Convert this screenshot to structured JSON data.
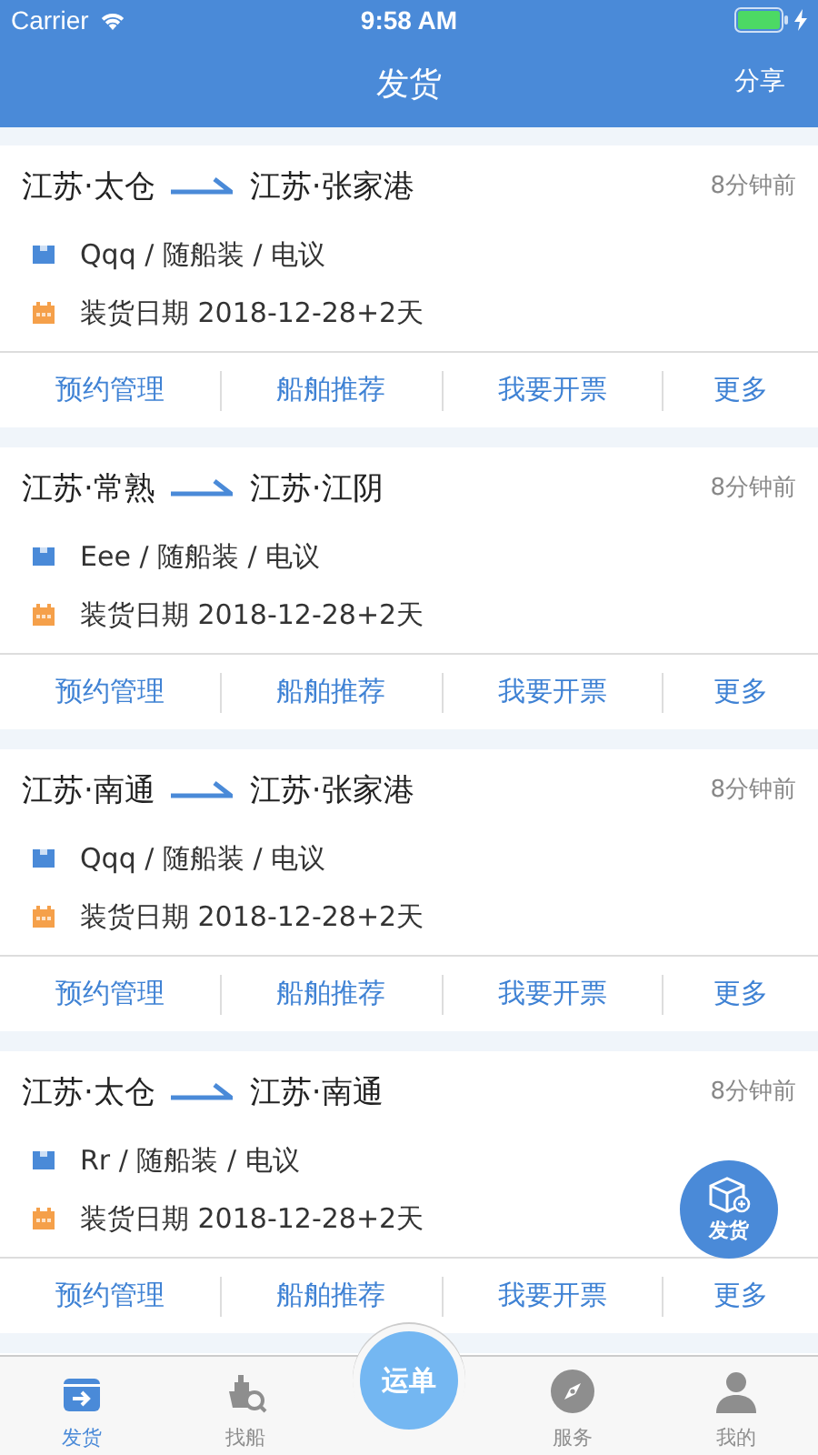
{
  "status_bar": {
    "carrier": "Carrier",
    "time": "9:58 AM",
    "battery_charging": true
  },
  "nav": {
    "title": "发货",
    "action": "分享"
  },
  "orders": [
    {
      "from": "江苏·太仓",
      "to": "江苏·张家港",
      "time": "8分钟前",
      "cargo": "Qqq / 随船装 / 电议",
      "date": "装货日期 2018-12-28+2天",
      "actions": [
        "预约管理",
        "船舶推荐",
        "我要开票",
        "更多"
      ]
    },
    {
      "from": "江苏·常熟",
      "to": "江苏·江阴",
      "time": "8分钟前",
      "cargo": "Eee / 随船装 / 电议",
      "date": "装货日期 2018-12-28+2天",
      "actions": [
        "预约管理",
        "船舶推荐",
        "我要开票",
        "更多"
      ]
    },
    {
      "from": "江苏·南通",
      "to": "江苏·张家港",
      "time": "8分钟前",
      "cargo": "Qqq / 随船装 / 电议",
      "date": "装货日期 2018-12-28+2天",
      "actions": [
        "预约管理",
        "船舶推荐",
        "我要开票",
        "更多"
      ]
    },
    {
      "from": "江苏·太仓",
      "to": "江苏·南通",
      "time": "8分钟前",
      "cargo": "Rr / 随船装 / 电议",
      "date": "装货日期 2018-12-28+2天",
      "actions": [
        "预约管理",
        "船舶推荐",
        "我要开票",
        "更多"
      ]
    }
  ],
  "fab": {
    "label": "发货"
  },
  "tabs": [
    {
      "kind": "ship",
      "label": "发货",
      "selected": true
    },
    {
      "kind": "find",
      "label": "找船",
      "selected": false
    },
    {
      "kind": "center",
      "label": "运单",
      "selected": false
    },
    {
      "kind": "service",
      "label": "服务",
      "selected": false
    },
    {
      "kind": "me",
      "label": "我的",
      "selected": false
    }
  ]
}
